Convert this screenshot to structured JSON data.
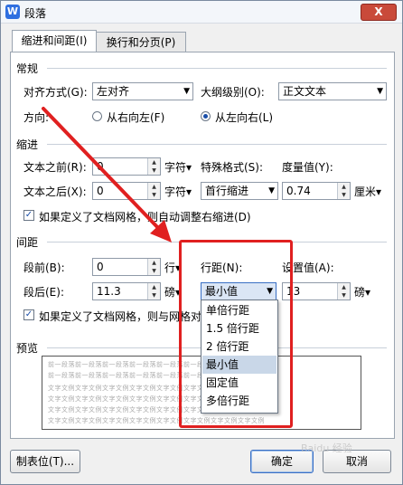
{
  "window": {
    "title": "段落",
    "app_icon": "W",
    "close_label": "X"
  },
  "tabs": [
    {
      "label": "缩进和间距(I)"
    },
    {
      "label": "换行和分页(P)"
    }
  ],
  "general": {
    "section_label": "常规",
    "alignment_label": "对齐方式(G):",
    "alignment_value": "左对齐",
    "outline_label": "大纲级别(O):",
    "outline_value": "正文文本",
    "direction_label": "方向:",
    "rtl_label": "从右向左(F)",
    "ltr_label": "从左向右(L)"
  },
  "indent": {
    "section_label": "缩进",
    "before_label": "文本之前(R):",
    "before_value": "0",
    "before_unit": "字符▾",
    "after_label": "文本之后(X):",
    "after_value": "0",
    "after_unit": "字符▾",
    "special_label": "特殊格式(S):",
    "special_value": "首行缩进",
    "measure_label": "度量值(Y):",
    "measure_value": "0.74",
    "measure_unit": "厘米▾",
    "grid_check_label": "如果定义了文档网格，则自动调整右缩进(D)"
  },
  "spacing": {
    "section_label": "间距",
    "before_label": "段前(B):",
    "before_value": "0",
    "before_unit": "行▾",
    "after_label": "段后(E):",
    "after_value": "11.3",
    "after_unit": "磅▾",
    "line_label": "行距(N):",
    "line_value": "最小值",
    "setting_label": "设置值(A):",
    "setting_value": "13",
    "setting_unit": "磅▾",
    "grid_check_label": "如果定义了文档网格，则与网格对"
  },
  "line_spacing_options": [
    "单倍行距",
    "1.5 倍行距",
    "2 倍行距",
    "最小值",
    "固定值",
    "多倍行距"
  ],
  "line_spacing_selected_index": 3,
  "preview": {
    "section_label": "预览",
    "prev_text": "前一段落前一段落前一段落前一段落前一段落前一段落前一段落前一段落",
    "sample_text": "文字文例文字文例文字文例文字文例文字文例文字文例文字文例文字文例"
  },
  "footer": {
    "tabs_button": "制表位(T)...",
    "ok_button": "确定",
    "cancel_button": "取消"
  },
  "watermark": "Baidu 经验",
  "colors": {
    "highlight": "#e02020",
    "accent": "#3a6fc4"
  }
}
